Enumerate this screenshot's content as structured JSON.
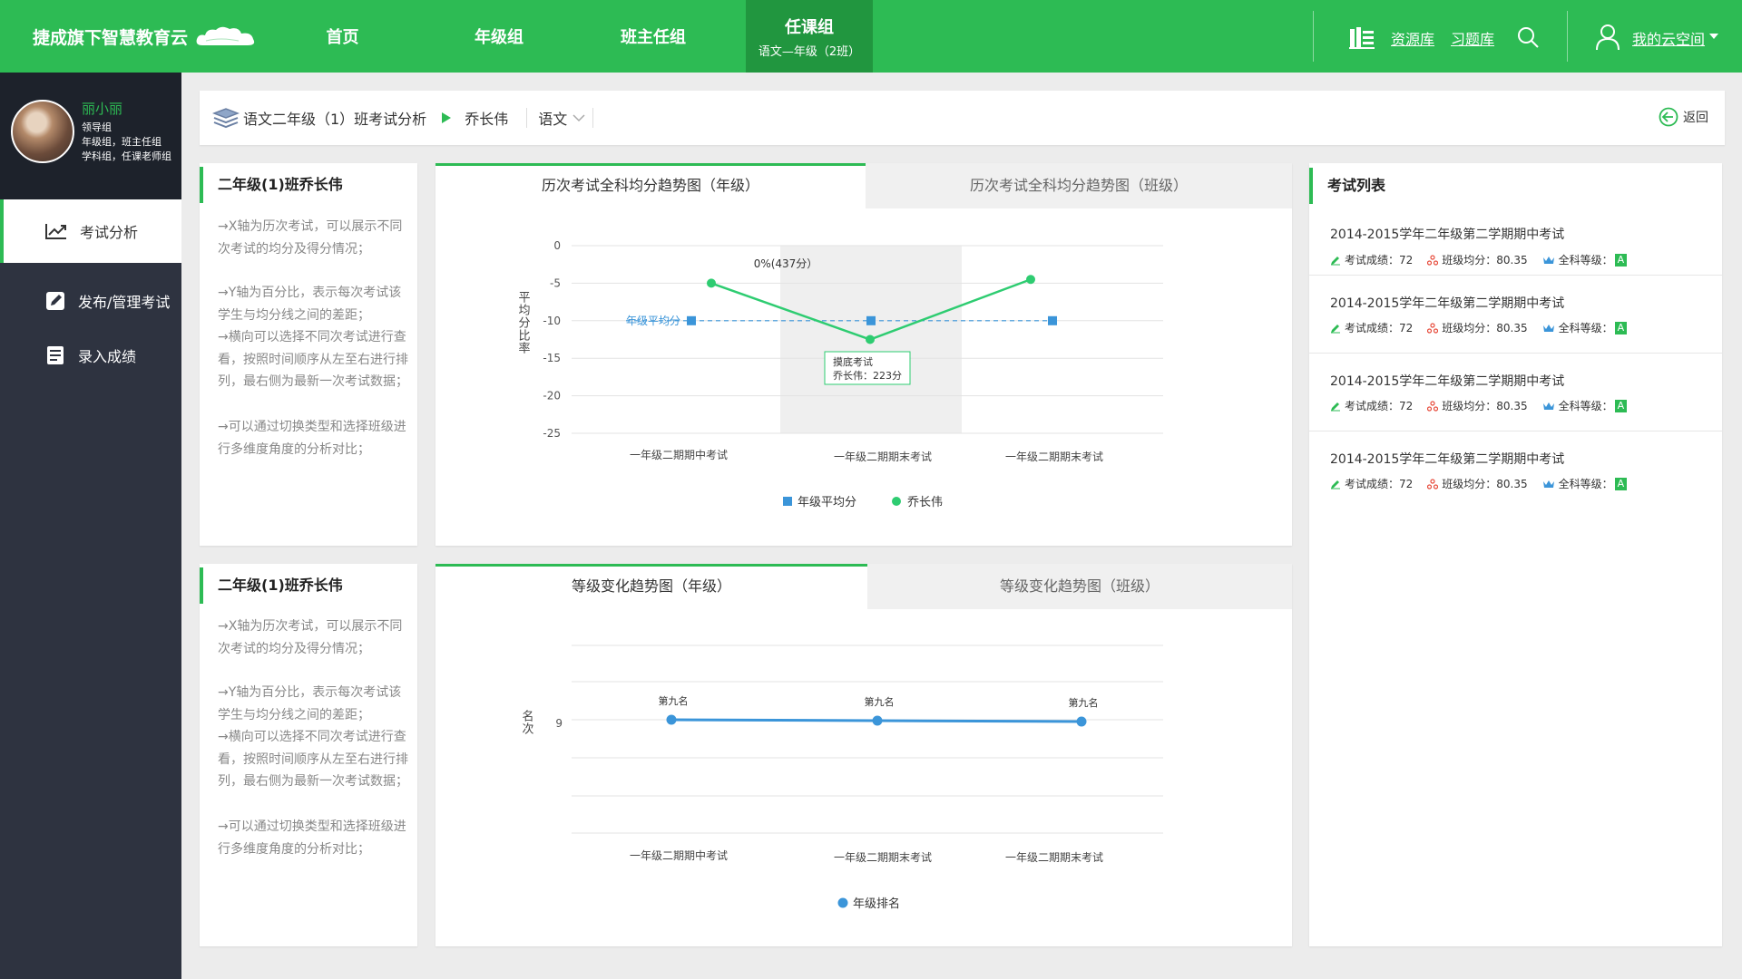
{
  "header": {
    "logo": "捷成旗下智慧教育云",
    "nav": [
      {
        "label": "首页"
      },
      {
        "label": "年级组"
      },
      {
        "label": "班主任组"
      },
      {
        "label": "任课组",
        "sub": "语文—年级（2班）"
      }
    ],
    "resource_link": "资源库",
    "exercise_link": "习题库",
    "space_link": "我的云空间"
  },
  "profile": {
    "name": "丽小丽",
    "lines": [
      "领导组",
      "年级组，班主任组",
      "学科组，任课老师组"
    ]
  },
  "sidebar": {
    "items": [
      {
        "label": "考试分析",
        "icon": "chart-line-icon"
      },
      {
        "label": "发布/管理考试",
        "icon": "edit-icon"
      },
      {
        "label": "录入成绩",
        "icon": "list-icon"
      }
    ]
  },
  "breadcrumb": {
    "title": "语文二年级（1）班考试分析",
    "student": "乔长伟",
    "subject": "语文",
    "back": "返回"
  },
  "panels": [
    {
      "title": "二年级(1)班乔长伟",
      "paragraphs": [
        "→X轴为历次考试，可以展示不同次考试的均分及得分情况；",
        "→Y轴为百分比，表示每次考试该学生与均分线之间的差距；\n→横向可以选择不同次考试进行查看，按照时间顺序从左至右进行排列，最右侧为最新一次考试数据；",
        "→可以通过切换类型和选择班级进行多维度角度的分析对比；"
      ]
    },
    {
      "title": "二年级(1)班乔长伟",
      "paragraphs": [
        "→X轴为历次考试，可以展示不同次考试的均分及得分情况；",
        "→Y轴为百分比，表示每次考试该学生与均分线之间的差距；\n→横向可以选择不同次考试进行查看，按照时间顺序从左至右进行排列，最右侧为最新一次考试数据；",
        "→可以通过切换类型和选择班级进行多维度角度的分析对比；"
      ]
    }
  ],
  "tabs1": [
    "历次考试全科均分趋势图（年级）",
    "历次考试全科均分趋势图（班级）"
  ],
  "tabs2": [
    "等级变化趋势图（年级）",
    "等级变化趋势图（班级）"
  ],
  "chart_data": [
    {
      "type": "line",
      "ylabel": "平均分比率",
      "categories": [
        "一年级二期期中考试",
        "一年级二期期末考试",
        "一年级二期期末考试"
      ],
      "ylim": [
        -25,
        0
      ],
      "yticks": [
        0,
        -5,
        -10,
        -15,
        -20,
        -25
      ],
      "grid": true,
      "legend": "bottom-center",
      "series": [
        {
          "name": "年级平均分",
          "values": [
            -10,
            -10,
            -10
          ],
          "color": "#3b95d9",
          "marker": "square",
          "dashed": true,
          "label": "年级平均分"
        },
        {
          "name": "乔长伟",
          "values": [
            -5,
            -12.5,
            -4.5
          ],
          "color": "#2ecc71",
          "marker": "circle"
        }
      ],
      "highlight_label": "0%(437分）",
      "tooltip": [
        "摸底考试",
        "乔长伟：223分"
      ]
    },
    {
      "type": "line",
      "ylabel": "名次",
      "categories": [
        "一年级二期期中考试",
        "一年级二期期末考试",
        "一年级二期期末考试"
      ],
      "yticks": [
        9
      ],
      "grid": true,
      "legend": "bottom-center",
      "series": [
        {
          "name": "年级排名",
          "values": [
            9,
            9,
            9
          ],
          "labels": [
            "第九名",
            "第九名",
            "第九名"
          ],
          "color": "#3b95d9",
          "marker": "circle"
        }
      ]
    }
  ],
  "exam_list": {
    "title": "考试列表",
    "items": [
      {
        "name": "2014-2015学年二年级第二学期期中考试",
        "score": "考试成绩：72",
        "avg": "班级均分：80.35",
        "level_label": "全科等级：",
        "level": "A"
      },
      {
        "name": "2014-2015学年二年级第二学期期中考试",
        "score": "考试成绩：72",
        "avg": "班级均分：80.35",
        "level_label": "全科等级：",
        "level": "A"
      },
      {
        "name": "2014-2015学年二年级第二学期期中考试",
        "score": "考试成绩：72",
        "avg": "班级均分：80.35",
        "level_label": "全科等级：",
        "level": "A"
      },
      {
        "name": "2014-2015学年二年级第二学期期中考试",
        "score": "考试成绩：72",
        "avg": "班级均分：80.35",
        "level_label": "全科等级：",
        "level": "A"
      }
    ]
  },
  "colors": {
    "brand": "#2dbb54",
    "brand_dark": "#21963f",
    "sidebar": "#2e3340"
  }
}
